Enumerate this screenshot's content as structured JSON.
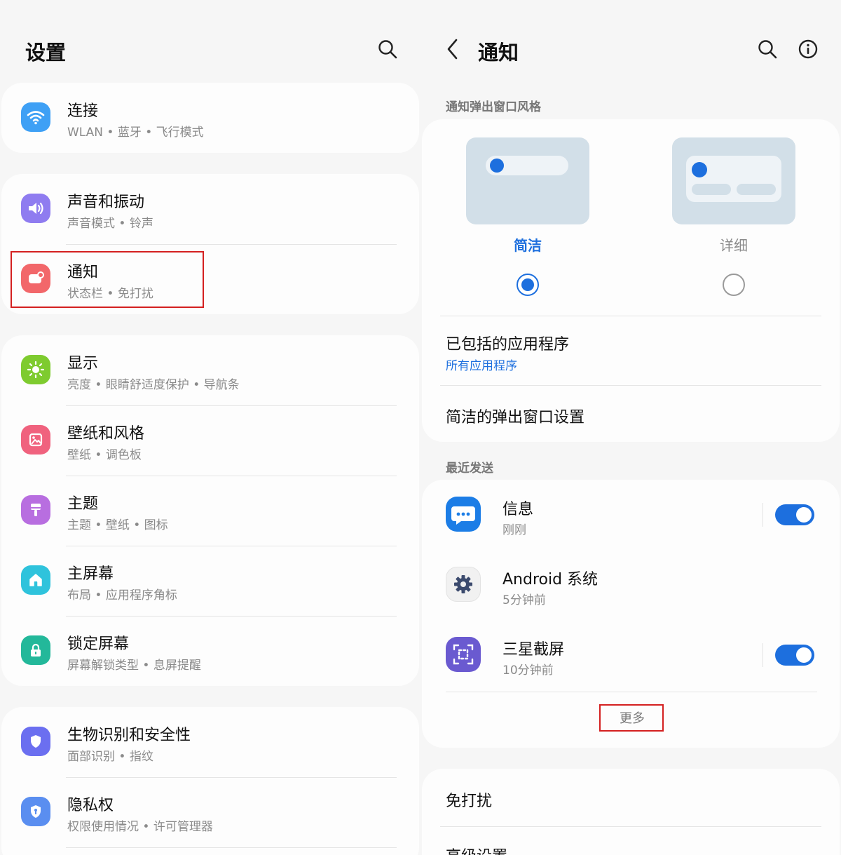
{
  "left": {
    "title": "设置",
    "groups": [
      {
        "items": [
          {
            "title": "连接",
            "subtitle": "WLAN • 蓝牙 • 飞行模式",
            "icon": "wifi-icon",
            "color": "#3ea0f5"
          }
        ]
      },
      {
        "items": [
          {
            "title": "声音和振动",
            "subtitle": "声音模式 • 铃声",
            "icon": "volume-icon",
            "color": "#8f7cf0"
          },
          {
            "title": "通知",
            "subtitle": "状态栏 • 免打扰",
            "icon": "notification-icon",
            "color": "#f2676a"
          }
        ]
      },
      {
        "items": [
          {
            "title": "显示",
            "subtitle": "亮度 • 眼睛舒适度保护 • 导航条",
            "icon": "sun-icon",
            "color": "#7ecb2f"
          },
          {
            "title": "壁纸和风格",
            "subtitle": "壁纸 • 调色板",
            "icon": "wallpaper-icon",
            "color": "#f0627e"
          },
          {
            "title": "主题",
            "subtitle": "主题 • 壁纸 • 图标",
            "icon": "theme-brush-icon",
            "color": "#b86ee0"
          },
          {
            "title": "主屏幕",
            "subtitle": "布局 • 应用程序角标",
            "icon": "home-icon",
            "color": "#2fc3dc"
          },
          {
            "title": "锁定屏幕",
            "subtitle": "屏幕解锁类型 • 息屏提醒",
            "icon": "lock-icon",
            "color": "#23b89a"
          }
        ]
      },
      {
        "items": [
          {
            "title": "生物识别和安全性",
            "subtitle": "面部识别 • 指纹",
            "icon": "shield-icon",
            "color": "#6b6ff0"
          },
          {
            "title": "隐私权",
            "subtitle": "权限使用情况 • 许可管理器",
            "icon": "privacy-shield-icon",
            "color": "#5a8ef0"
          }
        ]
      }
    ]
  },
  "right": {
    "title": "通知",
    "popup_section_label": "通知弹出窗口风格",
    "style_options": [
      {
        "label": "简洁",
        "selected": true
      },
      {
        "label": "详细",
        "selected": false
      }
    ],
    "included_apps": {
      "title": "已包括的应用程序",
      "value": "所有应用程序"
    },
    "brief_popup_settings": "简洁的弹出窗口设置",
    "recent_section_label": "最近发送",
    "recent_apps": [
      {
        "name": "信息",
        "time": "刚刚",
        "icon": "messages-icon",
        "toggle": true
      },
      {
        "name": "Android 系统",
        "time": "5分钟前",
        "icon": "android-system-gear-icon",
        "toggle": false
      },
      {
        "name": "三星截屏",
        "time": "10分钟前",
        "icon": "screenshot-icon",
        "toggle": true
      }
    ],
    "more_label": "更多",
    "do_not_disturb": "免打扰",
    "advanced": "高级设置"
  },
  "colors": {
    "accent": "#1d6fde",
    "highlight": "#d42020"
  }
}
